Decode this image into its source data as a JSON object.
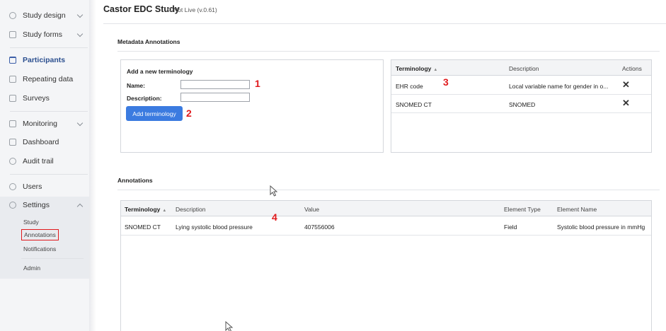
{
  "sidebar": {
    "items": [
      {
        "label": "Study design",
        "icon": "diagram-icon",
        "has_chevron": true
      },
      {
        "label": "Study forms",
        "icon": "form-icon",
        "has_chevron": true
      },
      {
        "label": "Participants",
        "icon": "folder-icon",
        "active": true
      },
      {
        "label": "Repeating data",
        "icon": "document-icon"
      },
      {
        "label": "Surveys",
        "icon": "document-icon"
      },
      {
        "label": "Monitoring",
        "icon": "monitor-icon",
        "has_chevron": true
      },
      {
        "label": "Dashboard",
        "icon": "chart-icon"
      },
      {
        "label": "Audit trail",
        "icon": "audit-icon"
      },
      {
        "label": "Users",
        "icon": "users-icon"
      },
      {
        "label": "Settings",
        "icon": "gear-icon",
        "has_chevron": true,
        "expanded": true
      }
    ],
    "settings_sub": [
      {
        "label": "Study"
      },
      {
        "label": "Annotations",
        "selected": true
      },
      {
        "label": "Notifications"
      },
      {
        "label": "Admin"
      }
    ]
  },
  "header": {
    "study_title": "Castor EDC Study",
    "status": "Not Live (v.0.61)"
  },
  "metadata": {
    "section_title": "Metadata Annotations",
    "add_form": {
      "title": "Add a new terminology",
      "name_label": "Name:",
      "name_value": "",
      "description_label": "Description:",
      "description_value": "",
      "button_label": "Add terminology"
    },
    "terminology_table": {
      "columns": [
        "Terminology",
        "Description",
        "Actions"
      ],
      "rows": [
        {
          "terminology": "EHR code",
          "description": "Local variable name for gender in o..."
        },
        {
          "terminology": "SNOMED CT",
          "description": "SNOMED"
        }
      ]
    }
  },
  "annotations": {
    "section_title": "Annotations",
    "columns": [
      "Terminology",
      "Description",
      "Value",
      "Element Type",
      "Element Name"
    ],
    "rows": [
      {
        "terminology": "SNOMED CT",
        "description": "Lying systolic blood pressure",
        "value": "407556006",
        "element_type": "Field",
        "element_name": "Systolic blood pressure in mmHg"
      }
    ]
  },
  "markers": [
    "1",
    "2",
    "3",
    "4"
  ],
  "colors": {
    "accent": "#3b7be0",
    "active_nav": "#2b4f8f",
    "marker": "#e0191c"
  }
}
